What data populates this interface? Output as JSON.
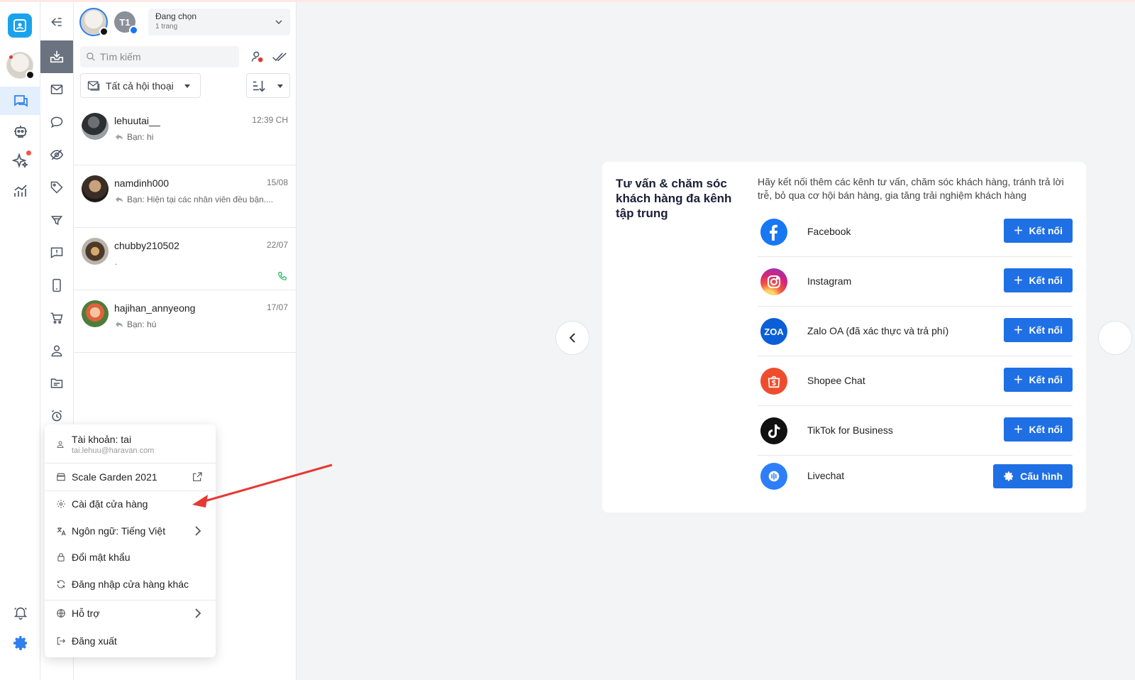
{
  "header": {
    "page_select_title": "Đang chọn",
    "page_select_subtitle": "1 trang",
    "page_avatar_initials": "T1"
  },
  "conversations": {
    "search_placeholder": "Tìm kiếm",
    "filter_label": "Tất cả hội thoại",
    "items": [
      {
        "name": "lehuutai__",
        "time": "12:39 CH",
        "preview": "Bạn: hi"
      },
      {
        "name": "namdinh000",
        "time": "15/08",
        "preview": "Bạn: Hiện tại các nhân viên đều bận...."
      },
      {
        "name": "chubby210502",
        "time": "22/07",
        "preview": "."
      },
      {
        "name": "hajihan_annyeong",
        "time": "17/07",
        "preview": "Bạn: hú"
      }
    ]
  },
  "menu": {
    "account_label": "Tài khoản: tai",
    "account_email": "tai.lehuu@haravan.com",
    "store_name": "Scale Garden 2021",
    "store_settings": "Cài đặt cửa hàng",
    "language": "Ngôn ngữ: Tiếng Việt",
    "change_password": "Đổi mật khẩu",
    "switch_store": "Đăng nhập cửa hàng khác",
    "support": "Hỗ trợ",
    "logout": "Đăng xuất"
  },
  "card": {
    "title": "Tư vấn & chăm sóc khách hàng đa kênh tập trung",
    "description": "Hãy kết nối thêm các kênh tư vấn, chăm sóc khách hàng, tránh trả lời trễ, bỏ qua cơ hội bán hàng, gia tăng trải nghiệm khách hàng",
    "channels": [
      {
        "name": "Facebook",
        "action": "Kết nối",
        "icon": "facebook-icon"
      },
      {
        "name": "Instagram",
        "action": "Kết nối",
        "icon": "instagram-icon"
      },
      {
        "name": "Zalo OA (đã xác thực và trả phí)",
        "action": "Kết nối",
        "icon": "zalo-icon",
        "logo_text": "ZOA"
      },
      {
        "name": "Shopee Chat",
        "action": "Kết nối",
        "icon": "shopee-icon"
      },
      {
        "name": "TikTok for Business",
        "action": "Kết nối",
        "icon": "tiktok-icon"
      },
      {
        "name": "Livechat",
        "action": "Cấu hình",
        "icon": "livechat-icon"
      }
    ]
  },
  "colors": {
    "accent": "#1f6fe5",
    "rail_active_bg": "#e3effd",
    "arrow": "#e53935"
  }
}
